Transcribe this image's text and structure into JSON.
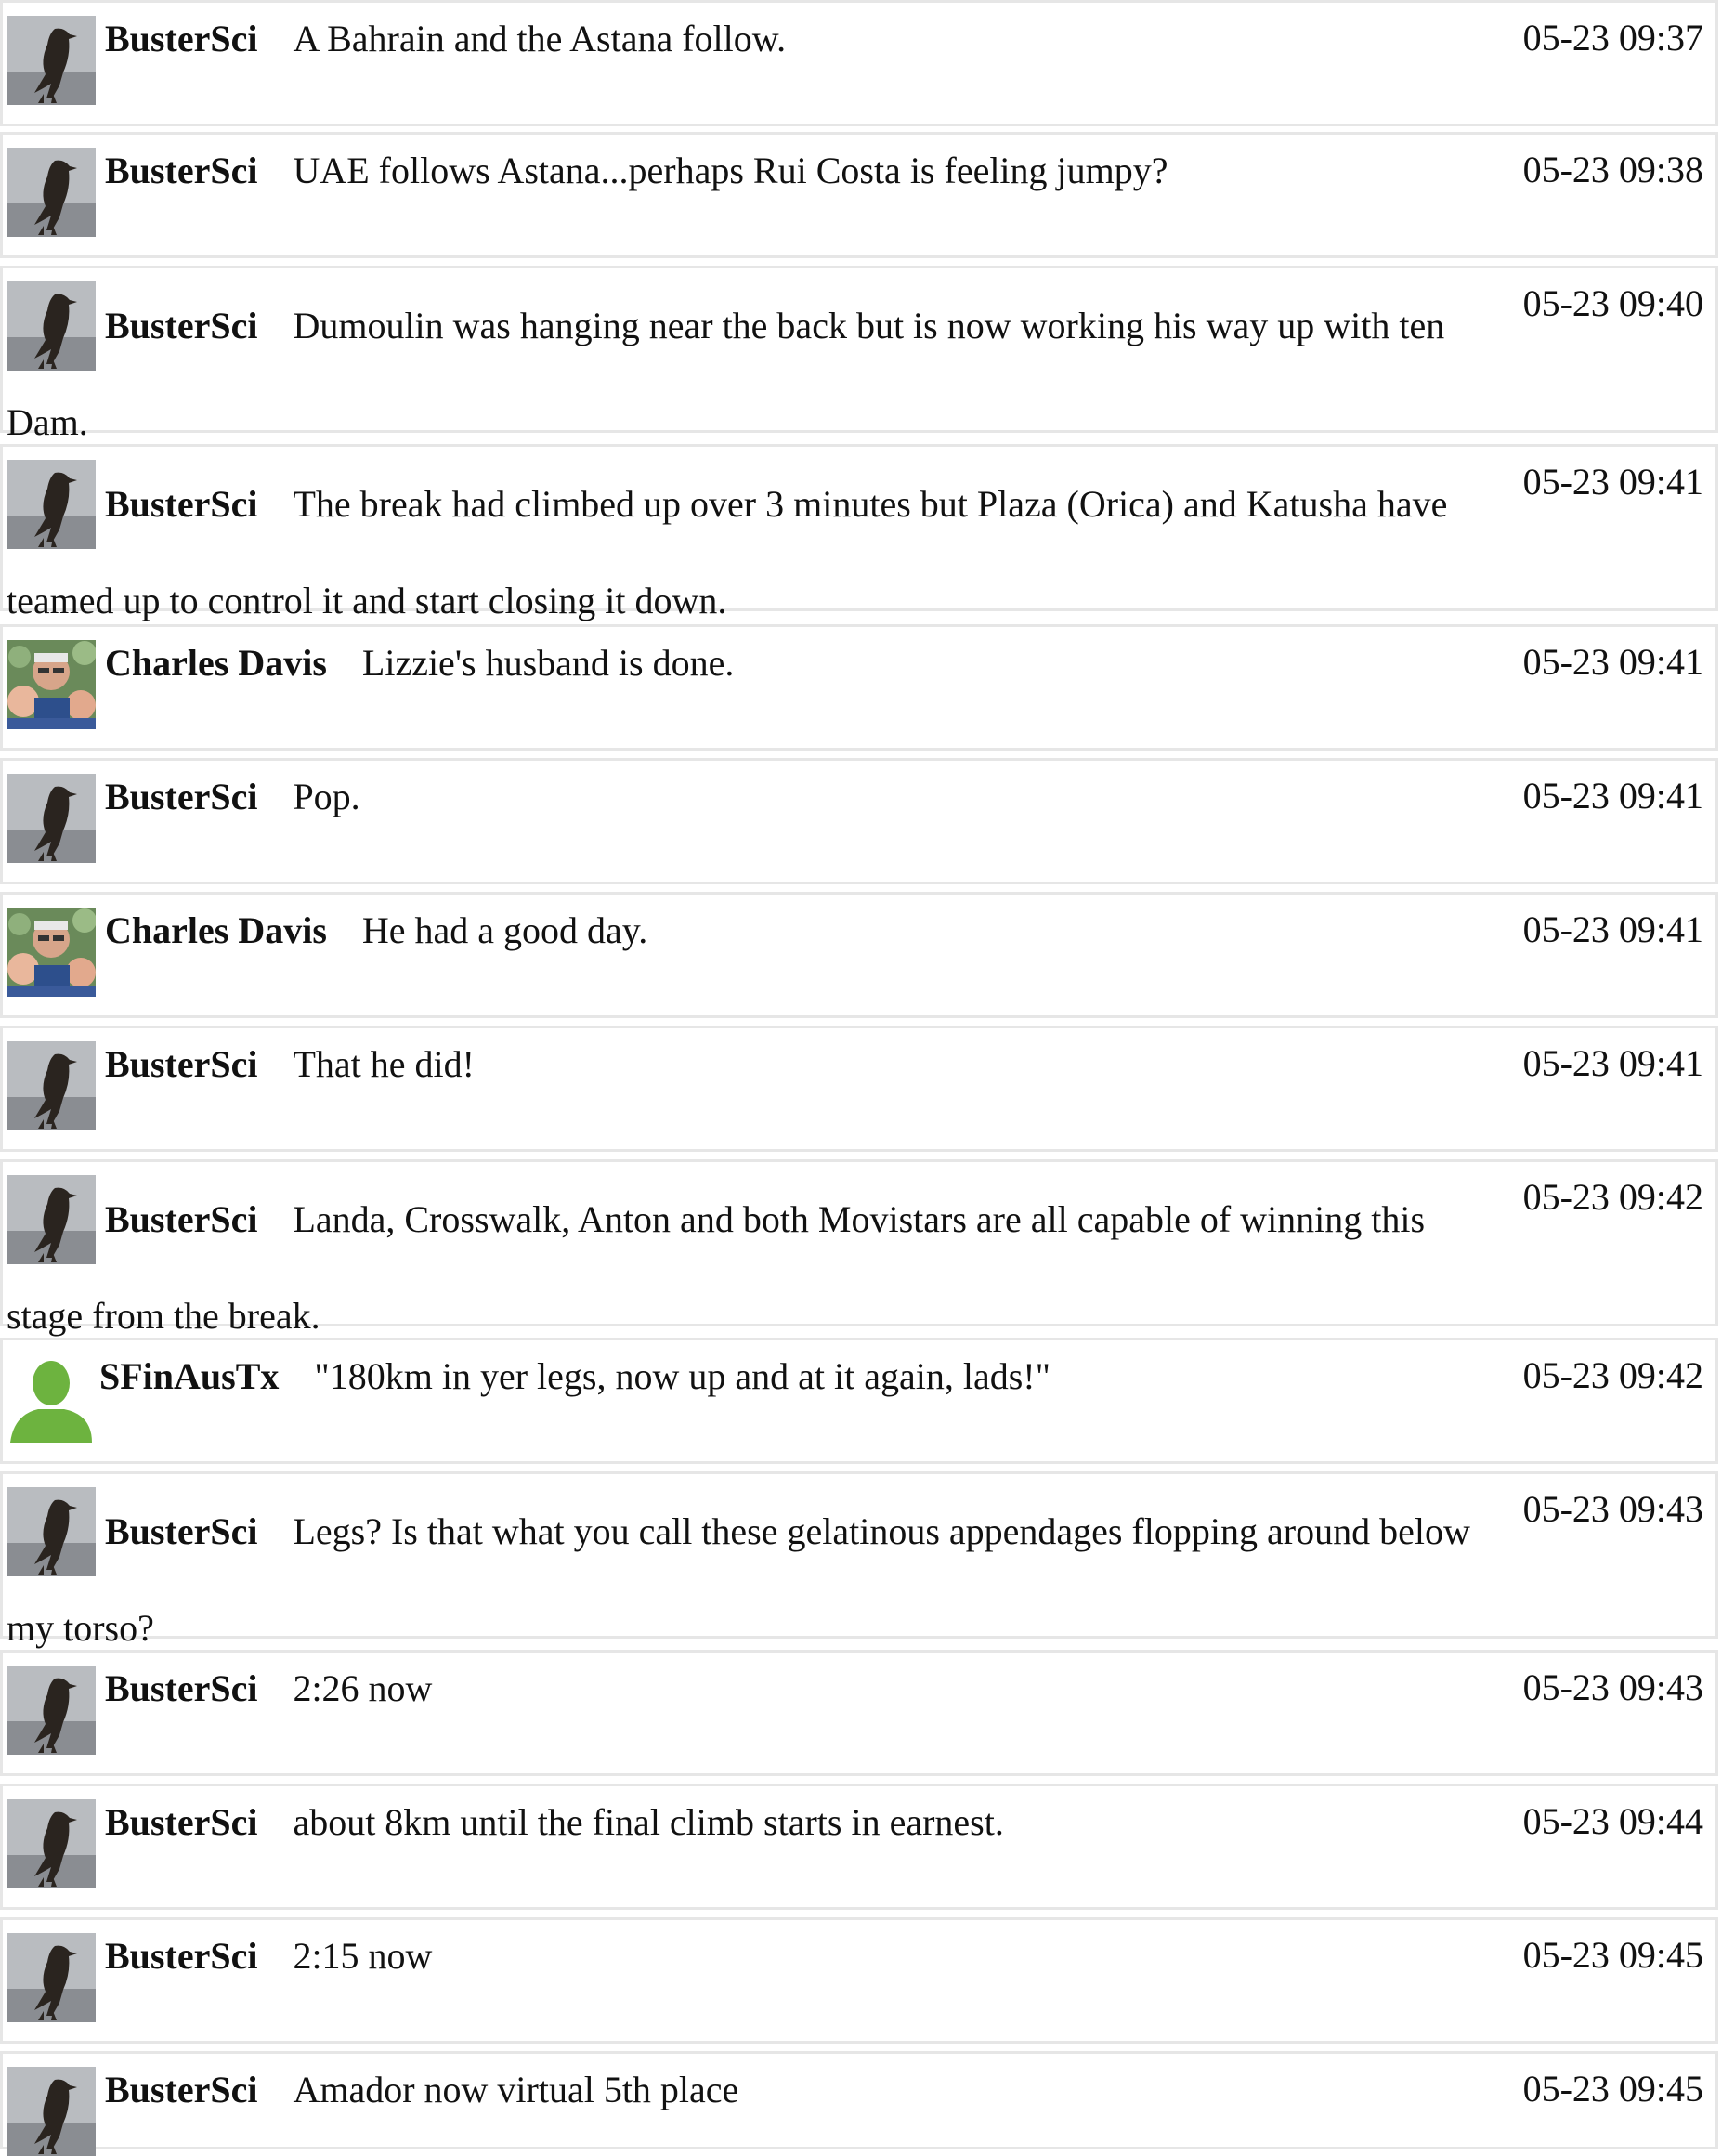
{
  "messages": [
    {
      "user": "BusterSci",
      "avatar": "penguin-avatar",
      "text": "A Bahrain and the Astana follow.",
      "time": "05-23 09:37"
    },
    {
      "user": "BusterSci",
      "avatar": "penguin-avatar",
      "text": "UAE follows Astana...perhaps Rui Costa is feeling jumpy?",
      "time": "05-23 09:38"
    },
    {
      "user": "BusterSci",
      "avatar": "penguin-avatar",
      "text": "Dumoulin was hanging near the back but is now working his way up with ten Dam.",
      "time": "05-23 09:40"
    },
    {
      "user": "BusterSci",
      "avatar": "penguin-avatar",
      "text": "The break had climbed up over 3 minutes but Plaza (Orica) and Katusha have teamed up to control it and start closing it down.",
      "time": "05-23 09:41"
    },
    {
      "user": "Charles Davis",
      "avatar": "family-photo-avatar",
      "text": "Lizzie's husband is done.",
      "time": "05-23 09:41"
    },
    {
      "user": "BusterSci",
      "avatar": "penguin-avatar",
      "text": "Pop.",
      "time": "05-23 09:41"
    },
    {
      "user": "Charles Davis",
      "avatar": "family-photo-avatar",
      "text": "He had a good day.",
      "time": "05-23 09:41"
    },
    {
      "user": "BusterSci",
      "avatar": "penguin-avatar",
      "text": "That he did!",
      "time": "05-23 09:41"
    },
    {
      "user": "BusterSci",
      "avatar": "penguin-avatar",
      "text": "Landa, Crosswalk, Anton and both Movistars are all capable of winning this stage from the break.",
      "time": "05-23 09:42"
    },
    {
      "user": "SFinAusTx",
      "avatar": "default-person-avatar",
      "text": "\"180km in yer legs, now up and at it again, lads!\"",
      "time": "05-23 09:42"
    },
    {
      "user": "BusterSci",
      "avatar": "penguin-avatar",
      "text": "Legs? Is that what you call these gelatinous appendages flopping around below my torso?",
      "time": "05-23 09:43"
    },
    {
      "user": "BusterSci",
      "avatar": "penguin-avatar",
      "text": "2:26 now",
      "time": "05-23 09:43"
    },
    {
      "user": "BusterSci",
      "avatar": "penguin-avatar",
      "text": "about 8km until the final climb starts in earnest.",
      "time": "05-23 09:44"
    },
    {
      "user": "BusterSci",
      "avatar": "penguin-avatar",
      "text": "2:15 now",
      "time": "05-23 09:45"
    },
    {
      "user": "BusterSci",
      "avatar": "penguin-avatar",
      "text": "Amador now virtual 5th place",
      "time": "05-23 09:45"
    }
  ]
}
